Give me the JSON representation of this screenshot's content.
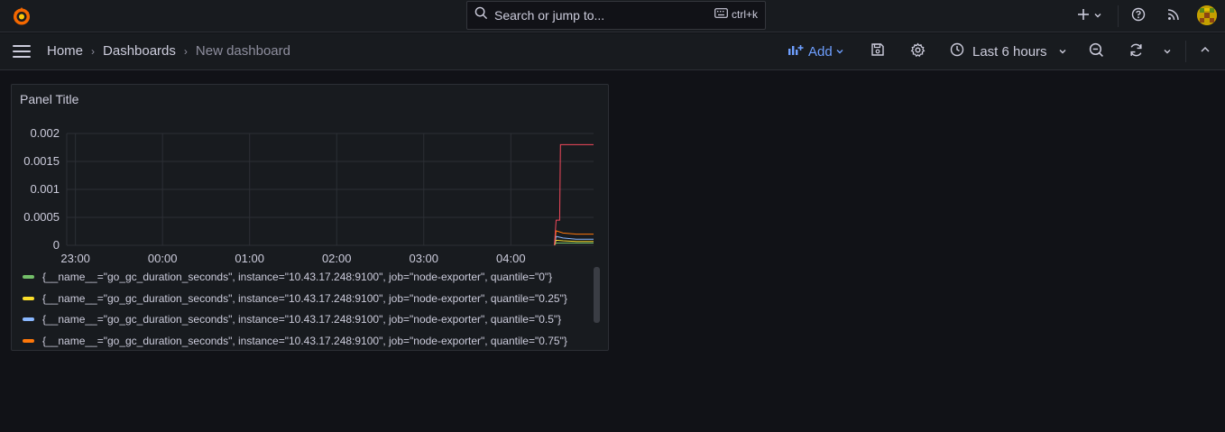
{
  "topbar": {
    "search_placeholder": "Search or jump to...",
    "shortcut": "ctrl+k",
    "icons": [
      "grafana-logo-icon",
      "search-icon",
      "keyboard-icon",
      "plus-icon",
      "chevron-down-icon",
      "help-icon",
      "rss-icon",
      "avatar"
    ]
  },
  "navbar": {
    "breadcrumbs": [
      "Home",
      "Dashboards",
      "New dashboard"
    ],
    "add_label": "Add",
    "time_range": "Last 6 hours",
    "icons": [
      "menu-icon",
      "add-panel-icon",
      "save-icon",
      "settings-icon",
      "clock-icon",
      "zoom-out-icon",
      "refresh-icon",
      "chevron-down-icon",
      "collapse-icon"
    ]
  },
  "panel": {
    "title": "Panel Title",
    "legend": [
      {
        "label": "{__name__=\"go_gc_duration_seconds\", instance=\"10.43.17.248:9100\", job=\"node-exporter\", quantile=\"0\"}",
        "color": "#73bf69"
      },
      {
        "label": "{__name__=\"go_gc_duration_seconds\", instance=\"10.43.17.248:9100\", job=\"node-exporter\", quantile=\"0.25\"}",
        "color": "#fade2a"
      },
      {
        "label": "{__name__=\"go_gc_duration_seconds\", instance=\"10.43.17.248:9100\", job=\"node-exporter\", quantile=\"0.5\"}",
        "color": "#8ab8ff"
      },
      {
        "label": "{__name__=\"go_gc_duration_seconds\", instance=\"10.43.17.248:9100\", job=\"node-exporter\", quantile=\"0.75\"}",
        "color": "#ff780a"
      }
    ]
  },
  "chart_data": {
    "type": "line",
    "title": "Panel Title",
    "xlabel": "",
    "ylabel": "",
    "x_ticks": [
      "23:00",
      "00:00",
      "01:00",
      "02:00",
      "03:00",
      "04:00"
    ],
    "y_ticks": [
      "0",
      "0.0005",
      "0.001",
      "0.0015",
      "0.002"
    ],
    "ylim": [
      0,
      0.002
    ],
    "xlim_hours": [
      -0.1,
      5.95
    ],
    "grid": true,
    "legend_position": "bottom",
    "series": [
      {
        "name": "{__name__=\"go_gc_duration_seconds\", instance=\"10.43.17.248:9100\", job=\"node-exporter\", quantile=\"0\"}",
        "color": "#73bf69",
        "x": [
          5.5,
          5.52,
          5.6,
          5.75,
          5.95
        ],
        "y": [
          0,
          4e-05,
          4e-05,
          4e-05,
          4e-05
        ]
      },
      {
        "name": "{__name__=\"go_gc_duration_seconds\", instance=\"10.43.17.248:9100\", job=\"node-exporter\", quantile=\"0.25\"}",
        "color": "#fade2a",
        "x": [
          5.5,
          5.52,
          5.6,
          5.75,
          5.95
        ],
        "y": [
          0,
          9e-05,
          8e-05,
          7e-05,
          7e-05
        ]
      },
      {
        "name": "{__name__=\"go_gc_duration_seconds\", instance=\"10.43.17.248:9100\", job=\"node-exporter\", quantile=\"0.5\"}",
        "color": "#8ab8ff",
        "x": [
          5.5,
          5.52,
          5.6,
          5.75,
          5.95
        ],
        "y": [
          0,
          0.00016,
          0.00013,
          0.00011,
          0.00011
        ]
      },
      {
        "name": "{__name__=\"go_gc_duration_seconds\", instance=\"10.43.17.248:9100\", job=\"node-exporter\", quantile=\"0.75\"}",
        "color": "#ff780a",
        "x": [
          5.5,
          5.52,
          5.6,
          5.75,
          5.95
        ],
        "y": [
          0,
          0.00026,
          0.00022,
          0.0002,
          0.0002
        ]
      },
      {
        "name": "",
        "color": "#f2495c",
        "x": [
          5.5,
          5.52,
          5.56,
          5.57,
          5.6,
          5.95
        ],
        "y": [
          0,
          0.00045,
          0.00045,
          0.0018,
          0.0018,
          0.0018
        ]
      }
    ]
  }
}
